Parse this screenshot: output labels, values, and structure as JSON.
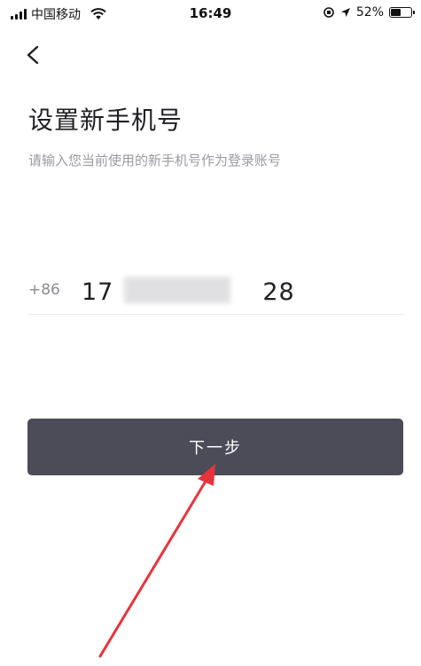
{
  "status_bar": {
    "carrier": "中国移动",
    "time": "16:49",
    "battery_percent": "52%",
    "battery_level": 0.52
  },
  "header": {
    "back_icon": "chevron-left-icon"
  },
  "main": {
    "title": "设置新手机号",
    "subtitle": "请输入您当前使用的新手机号作为登录账号",
    "country_code": "+86",
    "phone_value": "17　　　　　　28",
    "next_label": "下一步"
  },
  "colors": {
    "button_bg": "#4b4c57",
    "annotation_arrow": "#e8333a"
  }
}
